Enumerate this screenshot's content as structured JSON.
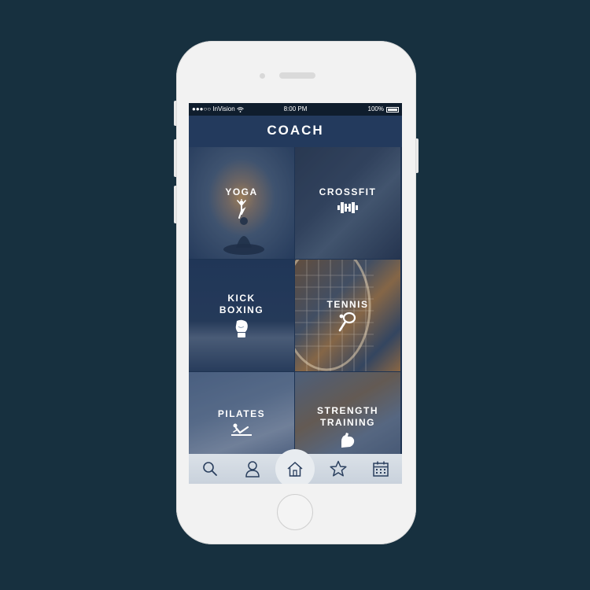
{
  "status_bar": {
    "carrier": "●●●○○ InVision",
    "time": "8:00 PM",
    "battery": "100%"
  },
  "header": {
    "title": "COACH"
  },
  "tiles": [
    {
      "label": "YOGA",
      "icon": "yoga-pose-icon"
    },
    {
      "label": "CROSSFIT",
      "icon": "dumbbell-icon"
    },
    {
      "label": "KICK\nBOXING",
      "icon": "boxing-glove-icon"
    },
    {
      "label": "TENNIS",
      "icon": "tennis-racket-icon"
    },
    {
      "label": "PILATES",
      "icon": "pilates-pose-icon"
    },
    {
      "label": "STRENGTH\nTRAINING",
      "icon": "flexed-arm-icon"
    }
  ],
  "tab_bar": {
    "items": [
      "search-icon",
      "profile-icon",
      "home-icon",
      "star-icon",
      "calendar-icon"
    ],
    "active": "home-icon"
  },
  "colors": {
    "background": "#17303f",
    "header": "#233a5d",
    "tab_bar": "#d2d9e1",
    "icon_stroke": "#2a3f5e"
  }
}
